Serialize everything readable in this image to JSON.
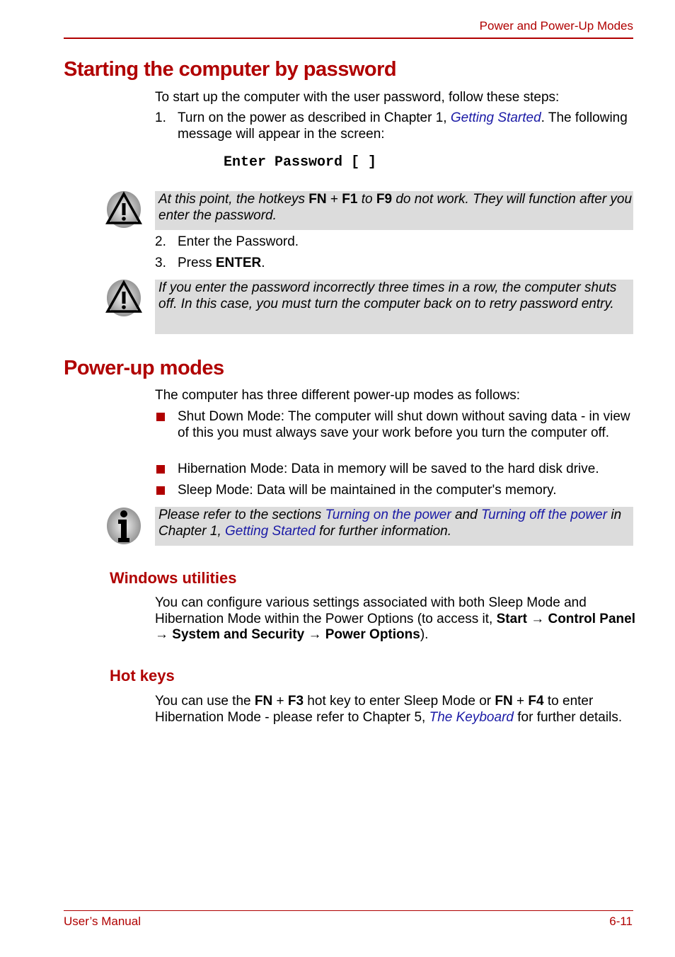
{
  "header": {
    "running_title": "Power and Power-Up Modes"
  },
  "section1": {
    "title": "Starting the computer by password",
    "intro": "To start up the computer with the user password, follow these steps:",
    "step1": {
      "num": "1.",
      "pre": "Turn on the power as described in Chapter 1, ",
      "link": "Getting Started",
      "post": ". The following message will appear in the screen:"
    },
    "screen_message": "Enter Password [ ]",
    "caution1": {
      "icon": "warning-icon",
      "t1": "At this point, the hotkeys ",
      "b1": "FN",
      "t2": " + ",
      "b2": "F1",
      "t3": " to ",
      "b3": "F9",
      "t4": " do not work. They will function after you enter the password."
    },
    "step2": {
      "num": "2.",
      "text": "Enter the Password."
    },
    "step3": {
      "num": "3.",
      "pre": "Press ",
      "bold": "ENTER",
      "post": "."
    },
    "caution2": {
      "icon": "warning-icon",
      "text": "If you enter the password incorrectly three times in a row, the computer shuts off. In this case, you must turn the computer back on to retry password entry."
    }
  },
  "section2": {
    "title": "Power-up modes",
    "intro": "The computer has three different power-up modes as follows:",
    "bullets": [
      "Shut Down Mode: The computer will shut down without saving data - in view of this you must always save your work before you turn the computer off.",
      "Hibernation Mode: Data in memory will be saved to the hard disk drive.",
      "Sleep Mode: Data will be maintained in the computer's memory."
    ],
    "info": {
      "icon": "info-icon",
      "t1": "Please refer to the sections ",
      "l1": "Turning on the power",
      "t2": " and ",
      "l2": "Turning off the power",
      "t3": " in Chapter 1, ",
      "l3": "Getting Started",
      "t4": " for further information."
    }
  },
  "windows_utilities": {
    "title": "Windows utilities",
    "t1": "You can configure various settings associated with both Sleep Mode and Hibernation Mode within the Power Options (to access it, ",
    "path": "Start → Control Panel → System and Security → Power Options",
    "t2": ")."
  },
  "hot_keys": {
    "title": "Hot keys",
    "t1": "You can use the ",
    "b1": "FN",
    "t2": " + ",
    "b2": "F3",
    "t3": " hot key to enter Sleep Mode or ",
    "b3": "FN",
    "t4": " + ",
    "b4": "F4",
    "t5": " to enter Hibernation Mode - please refer to Chapter 5, ",
    "link": "The Keyboard",
    "t6": " for further details."
  },
  "footer": {
    "left": "User’s Manual",
    "right": "6-11"
  },
  "colors": {
    "accent": "#b00000",
    "link": "#1a1aa6",
    "note_bg": "#dcdcdc"
  }
}
